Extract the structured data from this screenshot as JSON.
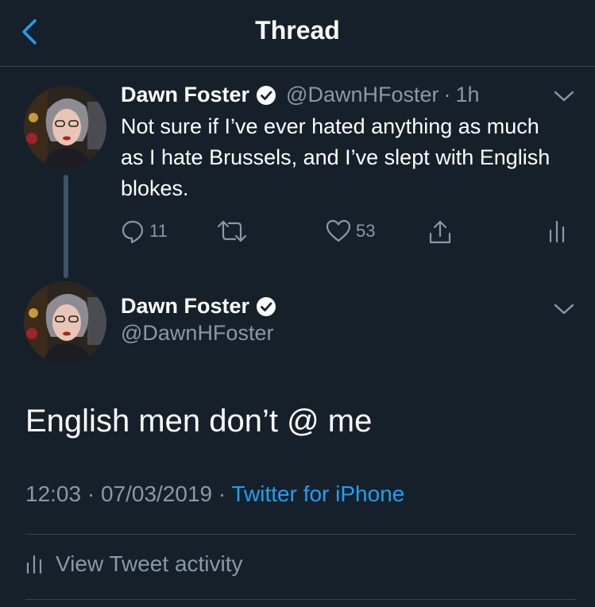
{
  "header": {
    "title": "Thread",
    "back_icon": "chevron-left-icon",
    "accent_color": "#1da1f2"
  },
  "parent_tweet": {
    "display_name": "Dawn Foster",
    "handle": "@DawnHFoster",
    "separator": "·",
    "time": "1h",
    "text": "Not sure if I’ve ever hated anything as much as I hate Brussels, and I’ve slept with English blokes.",
    "reply_count": "11",
    "retweet_count": "",
    "like_count": "53"
  },
  "focused_tweet": {
    "display_name": "Dawn Foster",
    "handle": "@DawnHFoster",
    "text": "English men don’t @ me",
    "timestamp": "12:03 · 07/03/2019 · ",
    "source": "Twitter for iPhone"
  },
  "activity": {
    "label": "View Tweet activity"
  },
  "colors": {
    "background": "#15202b",
    "secondary_text": "#8899a6",
    "divider": "#38444d",
    "link": "#1da1f2"
  }
}
